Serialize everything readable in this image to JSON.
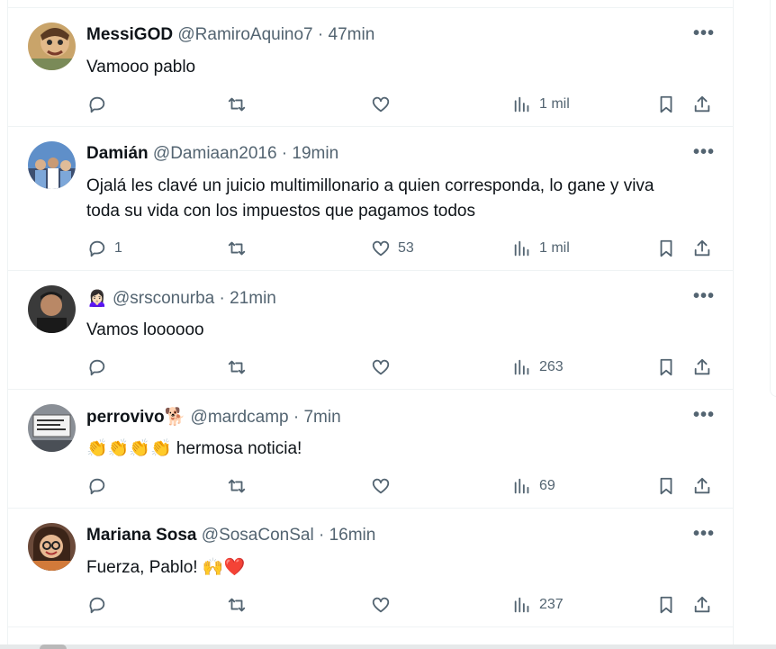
{
  "tweets": [
    {
      "name": "MessiGOD",
      "name_emoji": "",
      "handle": "@RamiroAquino7",
      "time": "47min",
      "lines": [
        "Vamooo pablo"
      ],
      "replies": "",
      "likes": "",
      "views": "1 mil",
      "avatar": "cartoon-face-avatar"
    },
    {
      "name": "Damián",
      "name_emoji": "",
      "handle": "@Damiaan2016",
      "time": "19min",
      "lines": [
        "Ojalá les clavé un juicio multimillonario a quien corresponda, lo gane y viva",
        "toda su vida con los impuestos que pagamos todos"
      ],
      "replies": "1",
      "likes": "53",
      "views": "1 mil",
      "avatar": "crowd-photo-avatar"
    },
    {
      "name": "",
      "name_emoji": "🙍🏻‍♀️",
      "handle": "@srsconurba",
      "time": "21min",
      "lines": [
        "Vamos loooooo"
      ],
      "replies": "",
      "likes": "",
      "views": "263",
      "avatar": "man-photo-avatar"
    },
    {
      "name": "perrovivo",
      "name_emoji": "🐕",
      "handle": "@mardcamp",
      "time": "7min",
      "lines": [
        "👏👏👏👏 hermosa noticia!"
      ],
      "replies": "",
      "likes": "",
      "views": "69",
      "avatar": "protest-sign-avatar"
    },
    {
      "name": "Mariana Sosa",
      "name_emoji": "",
      "handle": "@SosaConSal",
      "time": "16min",
      "lines": [
        "Fuerza, Pablo! 🙌❤️"
      ],
      "replies": "",
      "likes": "",
      "views": "237",
      "avatar": "woman-glasses-avatar"
    }
  ],
  "ui": {
    "separator": "·",
    "more_glyph": "•••"
  },
  "colors": {
    "text": "#0f1419",
    "muted": "#536471",
    "border": "#eff3f4"
  }
}
